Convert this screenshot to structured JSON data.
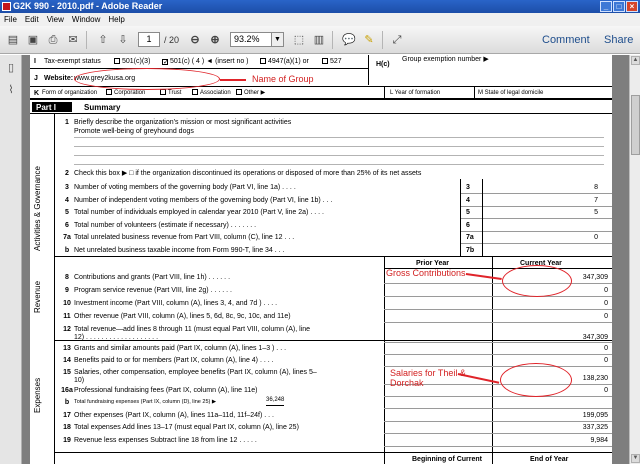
{
  "window": {
    "title": "G2K 990 - 2010.pdf - Adobe Reader"
  },
  "menu": [
    "File",
    "Edit",
    "View",
    "Window",
    "Help"
  ],
  "toolbar": {
    "page_current": "1",
    "page_total": "/ 20",
    "zoom": "93.2%",
    "comment": "Comment",
    "share": "Share"
  },
  "form": {
    "tax_exempt": {
      "label": "Tax-exempt status",
      "opt1": "501(c)(3)",
      "opt2": "501(c) ( 4 )",
      "opt2_insert": "(insert no )",
      "opt3": "4947(a)(1) or",
      "opt4": "527"
    },
    "hc": "H(c)",
    "group_exemption": "Group exemption number",
    "website_label": "Website:",
    "website_value": "www.grey2kusa.org",
    "form_org": {
      "label": "Form of organization",
      "corp": "Corporation",
      "trust": "Trust",
      "assoc": "Association",
      "other": "Other"
    },
    "year_formation": "L Year of formation",
    "state_domicile": "M State of legal domicile",
    "part": "Part I",
    "summary": "Summary",
    "row1": {
      "num": "1",
      "text": "Briefly describe the organization's mission or most significant activities",
      "answer": "Promote well-being of greyhound dogs"
    },
    "row2": {
      "num": "2",
      "text": "Check this box ▶ □ if the organization discontinued its operations or disposed of more than 25% of its net assets"
    },
    "gov_rows": [
      {
        "num": "3",
        "text": "Number of voting members of the governing body (Part VI, line 1a)  .  .  .  .",
        "box": "3",
        "value": "8"
      },
      {
        "num": "4",
        "text": "Number of independent voting members of the governing body (Part VI, line 1b)  .  .  .",
        "box": "4",
        "value": "7"
      },
      {
        "num": "5",
        "text": "Total number of individuals employed in calendar year 2010 (Part V, line 2a)  .  .  .  .",
        "box": "5",
        "value": "5"
      },
      {
        "num": "6",
        "text": "Total number of volunteers (estimate if necessary)  .  .  .  .  .  .  .",
        "box": "6",
        "value": ""
      },
      {
        "num": "7a",
        "text": "Total unrelated business revenue from Part VIII, column (C), line 12  .  .  .",
        "box": "7a",
        "value": "0"
      },
      {
        "num": "b",
        "text": "Net unrelated business taxable income from Form 990-T, line 34  .  .  .",
        "box": "7b",
        "value": ""
      }
    ],
    "side_gov": "Activities & Governance",
    "side_rev": "Revenue",
    "side_exp": "Expenses",
    "col_prior": "Prior Year",
    "col_current": "Current Year",
    "rev_rows": [
      {
        "num": "8",
        "text": "Contributions and grants (Part VIII, line 1h)  .  .  .  .  .  .",
        "value": "347,309"
      },
      {
        "num": "9",
        "text": "Program service revenue (Part VIII, line 2g)  .  .  .  .  .  .",
        "value": "0"
      },
      {
        "num": "10",
        "text": "Investment income (Part VIII, column (A), lines 3, 4, and 7d )  .  .  .  .",
        "value": "0"
      },
      {
        "num": "11",
        "text": "Other revenue (Part VIII, column (A), lines 5, 6d, 8c, 9c, 10c, and 11e)",
        "value": "0"
      },
      {
        "num": "12",
        "text": "Total revenue—add lines 8 through 11 (must equal Part VIII, column (A), line",
        "text2": "12)  .  .  .  .  .  .  .  .  .  .  .  .  .  .  .  .  .  .  .",
        "value": "347,309"
      }
    ],
    "exp_rows": [
      {
        "num": "13",
        "text": "Grants and similar amounts paid (Part IX, column (A), lines 1–3 )  .  .  .",
        "value": "0"
      },
      {
        "num": "14",
        "text": "Benefits paid to or for members (Part IX, column (A), line 4)  .  .  .  .",
        "value": "0"
      },
      {
        "num": "15",
        "text": "Salaries, other compensation, employee benefits (Part IX, column (A), lines 5–",
        "text2": "10)",
        "value": "138,230"
      },
      {
        "num": "16a",
        "text": "Professional fundraising fees (Part IX, column (A), line 11e)",
        "value": "0"
      },
      {
        "num": "b",
        "text": "Total fundraising expenses (Part IX, column (D), line 25) ▶",
        "extra": "36,248",
        "value": ""
      },
      {
        "num": "17",
        "text": "Other expenses (Part IX, column (A), lines 11a–11d, 11f–24f)  .  .  .",
        "value": "199,095"
      },
      {
        "num": "18",
        "text": "Total expenses  Add lines 13–17 (must equal Part IX, column (A), line 25)",
        "value": "337,325"
      },
      {
        "num": "19",
        "text": "Revenue less expenses  Subtract line 18 from line 12  .  .  .  .  .",
        "value": "9,984"
      }
    ],
    "net_header_a": "Beginning of Current",
    "net_header_b": "End of Year"
  },
  "annotations": {
    "name_group": "Name of Group",
    "gross_contrib": "Gross Contributions",
    "salaries_line1": "Salaries for Theil &",
    "salaries_line2": "Dorchak"
  },
  "colors": {
    "annotation": "#e0242a",
    "titlebar": "#2a64c8",
    "doc_bg": "#7e7e7e"
  }
}
